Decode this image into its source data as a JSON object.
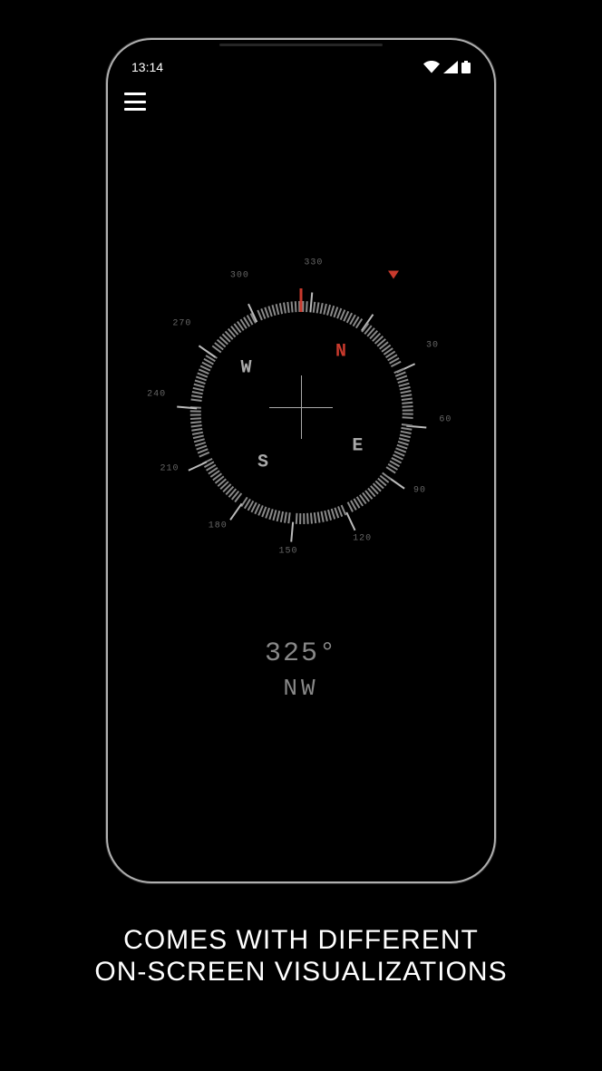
{
  "statusbar": {
    "time": "13:14"
  },
  "compass": {
    "heading_deg": 325,
    "heading_text": "325°",
    "direction_text": "NW",
    "rotation": 35,
    "cardinals": [
      {
        "label": "N",
        "deg": 0,
        "north": true
      },
      {
        "label": "E",
        "deg": 90,
        "north": false
      },
      {
        "label": "S",
        "deg": 180,
        "north": false
      },
      {
        "label": "W",
        "deg": 270,
        "north": false
      }
    ],
    "labels": [
      {
        "label": "30",
        "deg": 30
      },
      {
        "label": "60",
        "deg": 60
      },
      {
        "label": "90",
        "deg": 90
      },
      {
        "label": "120",
        "deg": 120
      },
      {
        "label": "150",
        "deg": 150
      },
      {
        "label": "180",
        "deg": 180
      },
      {
        "label": "210",
        "deg": 210
      },
      {
        "label": "240",
        "deg": 240
      },
      {
        "label": "270",
        "deg": 270
      },
      {
        "label": "300",
        "deg": 300
      },
      {
        "label": "330",
        "deg": 330
      }
    ]
  },
  "caption": {
    "line1": "COMES WITH DIFFERENT",
    "line2": "ON-SCREEN VISUALIZATIONS"
  }
}
